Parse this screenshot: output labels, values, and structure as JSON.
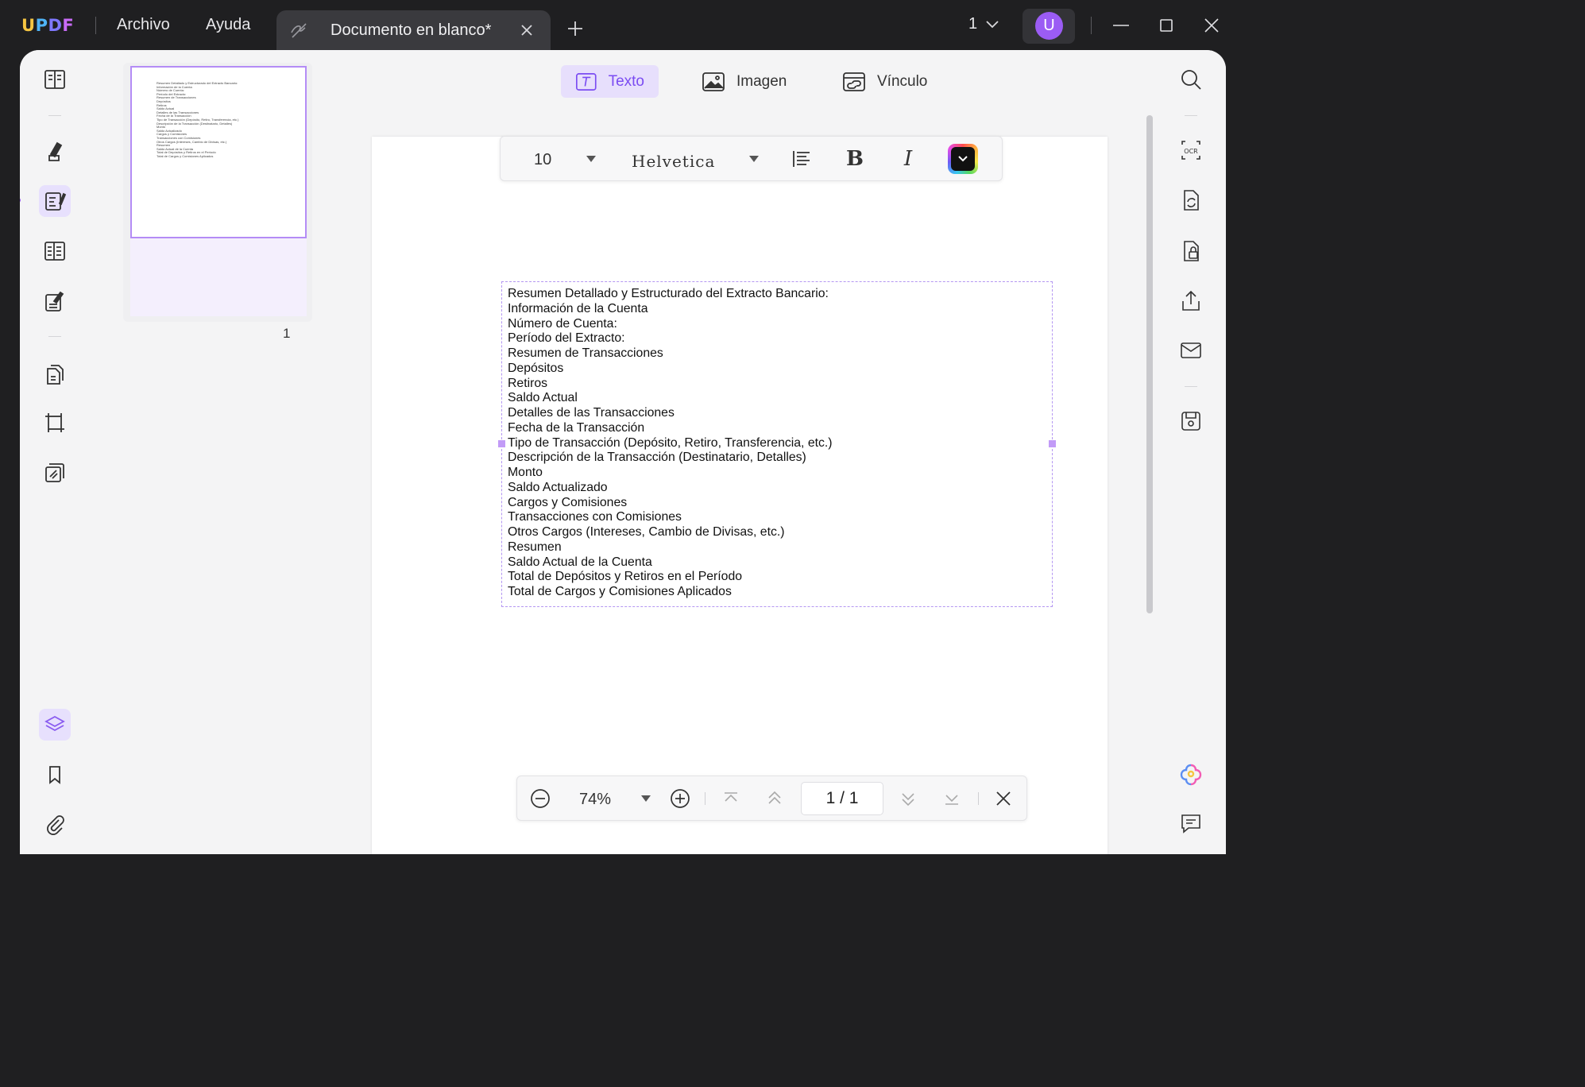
{
  "app": {
    "logo": {
      "u": "U",
      "p": "P",
      "d": "D",
      "f": "F"
    },
    "menu": [
      "Archivo",
      "Ayuda"
    ],
    "tab_title": "Documento en blanco*",
    "page_selector": "1",
    "avatar_initial": "U",
    "accent_color": "#9b5cf4"
  },
  "left_rail": {
    "icons": [
      "reader-icon",
      "highlighter-icon",
      "edit-pdf-icon",
      "form-icon",
      "fill-sign-icon",
      "organize-pages-icon",
      "crop-icon",
      "watermark-icon",
      "layers-icon",
      "bookmark-icon",
      "attachment-icon"
    ],
    "active": "edit-pdf-icon"
  },
  "thumbnails": {
    "page_label": "1",
    "preview_text": "Resumen Detallado y Estructurado del Extracto Bancario:\nInformación de la Cuenta\nNúmero de Cuenta:\nPeríodo del Extracto:\nResumen de Transacciones\nDepósitos\nRetiros\nSaldo Actual\nDetalles de las Transacciones\nFecha de la Transacción\nTipo de Transacción (Depósito, Retiro, Transferencia, etc.)\nDescripción de la Transacción (Destinatario, Detalles)\nMonto\nSaldo Actualizado\nCargos y Comisiones\nTransacciones con Comisiones\nOtros Cargos (Intereses, Cambio de Divisas, etc.)\nResumen\nSaldo Actual de la Cuenta\nTotal de Depósitos y Retiros en el Período\nTotal de Cargos y Comisiones Aplicados"
  },
  "edit_tabs": {
    "text": "Texto",
    "image": "Imagen",
    "link": "Vínculo",
    "active": "text"
  },
  "format_bar": {
    "font_size": "10",
    "font_family": "Helvetica",
    "align": "left",
    "bold_label": "B",
    "italic_label": "I"
  },
  "document": {
    "lines": [
      "Resumen Detallado y Estructurado del Extracto Bancario:",
      "Información de la Cuenta",
      "Número de Cuenta:",
      "Período del Extracto:",
      "Resumen de Transacciones",
      "Depósitos",
      "Retiros",
      "Saldo Actual",
      "Detalles de las Transacciones",
      "Fecha de la Transacción",
      "Tipo de Transacción (Depósito, Retiro, Transferencia, etc.)",
      "Descripción de la Transacción (Destinatario, Detalles)",
      "Monto",
      "Saldo Actualizado",
      "Cargos y Comisiones",
      "Transacciones con Comisiones",
      "Otros Cargos (Intereses, Cambio de Divisas, etc.)",
      "Resumen",
      "Saldo Actual de la Cuenta",
      "Total de Depósitos y Retiros en el Período",
      "Total de Cargos y Comisiones Aplicados"
    ]
  },
  "zoom_bar": {
    "zoom": "74%",
    "page_indicator": "1 / 1"
  },
  "right_rail": {
    "icons": [
      "search-icon",
      "ocr-icon",
      "convert-icon",
      "protect-icon",
      "share-icon",
      "email-icon",
      "save-icon",
      "ai-assistant-icon",
      "comment-icon"
    ]
  }
}
